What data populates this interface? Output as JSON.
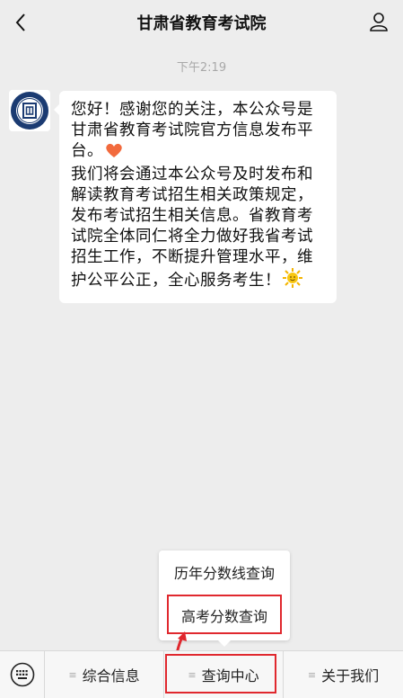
{
  "header": {
    "title": "甘肃省教育考试院",
    "back_icon": "chevron-left-icon",
    "profile_icon": "person-icon"
  },
  "chat": {
    "timestamp": "下午2:19",
    "message": {
      "line1": "您好！感谢您的关注，本公众号是甘肃省教育考试院官方信息发布平台。",
      "line2": "我们将会通过本公众号及时发布和解读教育考试招生相关政策规定，发布考试招生相关信息。省教育考试院全体同仁将全力做好我省考试招生工作，不断提升管理水平，维护公平公正，全心服务考生！",
      "emoji1": "heart-icon",
      "emoji2": "sun-icon"
    }
  },
  "popup_menu": {
    "items": [
      {
        "label": "历年分数线查询"
      },
      {
        "label": "高考分数查询"
      }
    ]
  },
  "bottom_menu": {
    "keyboard_icon": "keyboard-icon",
    "items": [
      {
        "label": "综合信息"
      },
      {
        "label": "查询中心"
      },
      {
        "label": "关于我们"
      }
    ]
  },
  "colors": {
    "background": "#ededed",
    "highlight": "#e0282e",
    "bubble": "#ffffff"
  }
}
